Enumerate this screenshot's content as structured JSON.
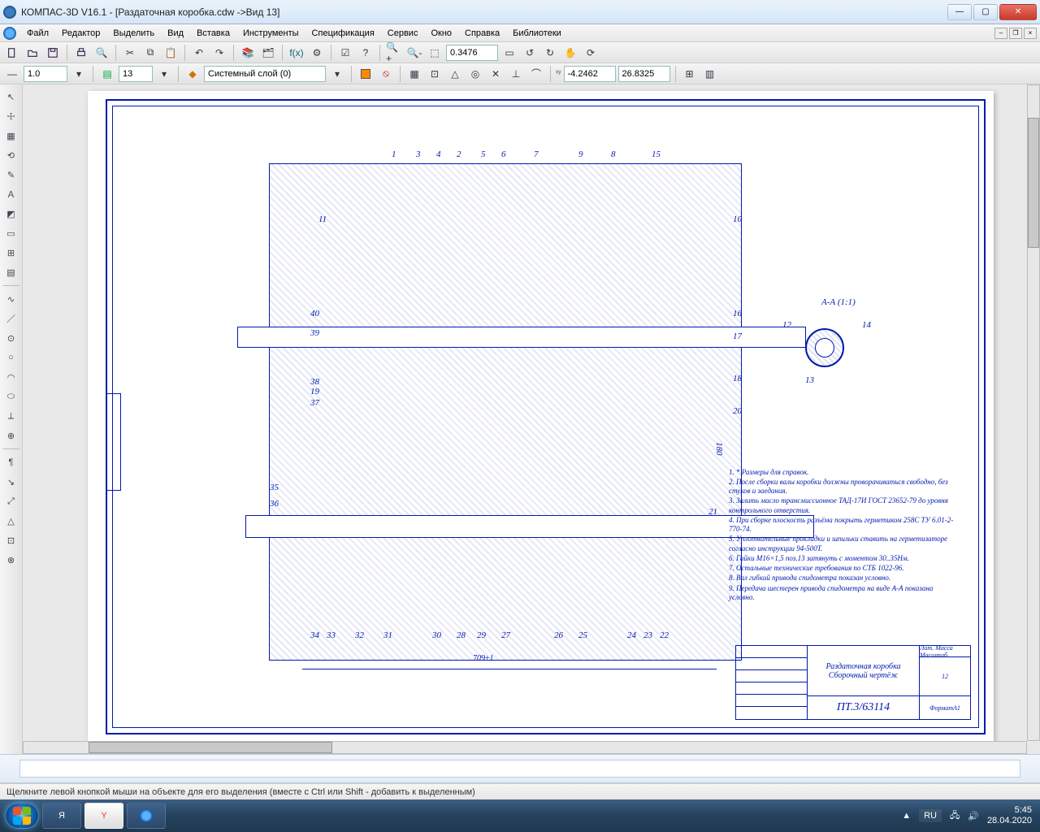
{
  "title": "КОМПАС-3D V16.1 - [Раздаточная коробка.cdw ->Вид 13]",
  "menu": [
    "Файл",
    "Редактор",
    "Выделить",
    "Вид",
    "Вставка",
    "Инструменты",
    "Спецификация",
    "Сервис",
    "Окно",
    "Справка",
    "Библиотеки"
  ],
  "toolbar1": {
    "zoom_value": "0.3476"
  },
  "toolbar2": {
    "line_width": "1.0",
    "view_number": "13",
    "layer_label": "Системный слой (0)",
    "coord_x": "-4.2462",
    "coord_y": "26.8325"
  },
  "left_tools": [
    "↖",
    "☩",
    "▦",
    "⟲",
    "✎",
    "Ａ",
    "◩",
    "▭",
    "⊞",
    "▤",
    "∿",
    "／",
    "⊙",
    "○",
    "◠",
    "⬭",
    "⟂",
    "⊕",
    "¶",
    "↘",
    "⤢",
    "△",
    "⊡",
    "⊗"
  ],
  "drawing": {
    "top_callouts": [
      "1",
      "3",
      "4",
      "2",
      "5",
      "6",
      "7",
      "9",
      "8",
      "15"
    ],
    "top_extra": [
      "11",
      "10"
    ],
    "left_callouts": [
      "40",
      "39",
      "38",
      "19",
      "37",
      "35",
      "36"
    ],
    "right_callouts": [
      "16",
      "17",
      "18",
      "20",
      "21"
    ],
    "bottom_callouts": [
      "34",
      "33",
      "32",
      "31",
      "30",
      "28",
      "29",
      "27",
      "26",
      "25",
      "24",
      "23",
      "22"
    ],
    "detail_label": "А-А (1:1)",
    "detail_nums": [
      "12",
      "14",
      "13"
    ],
    "bottom_dim": "709±1",
    "right_dim": "180",
    "notes": [
      "1. * Размеры для справок.",
      "2. После сборки валы коробки должны проворачиваться свободно, без стуков и заедания.",
      "3. Залить масло трансмиссионное ТАД-17И ГОСТ 23652-79 до уровня контрольного отверстия.",
      "4. При сборке плоскость разъёма покрыть герметиком 258С ТУ 6.01-2-770-74.",
      "5. Уплотнительные прокладки и шпильки ставить на герметизаторе согласно инструкции 94-500Т.",
      "6. Гайки М16×1,5 поз.13 затянуть с моментом 30..35Нм.",
      "7. Остальные технические требования по СТБ 1022-96.",
      "8. Вал гибкий привода спидометра показан условно.",
      "9. Передача шестерен привода спидометра на виде А-А показана условно."
    ],
    "title_block": {
      "name_line1": "Раздаточная коробка",
      "name_line2": "Сборочный чертёж",
      "code": "ПТ.3/63114",
      "sheet_lit": "12",
      "format": "А1"
    }
  },
  "status": "Щелкните левой кнопкой мыши на объекте для его выделения (вместе с Ctrl или Shift - добавить к выделенным)",
  "taskbar": {
    "apps": [
      "Я",
      "Y",
      "К"
    ],
    "lang": "RU",
    "time": "5:45",
    "date": "28.04.2020"
  }
}
